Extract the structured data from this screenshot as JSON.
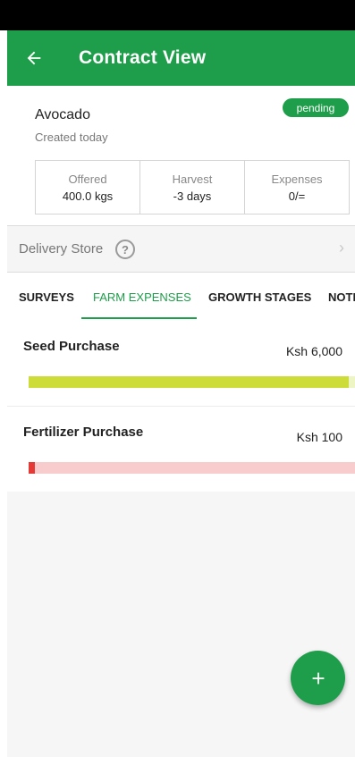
{
  "app_bar": {
    "title": "Contract View",
    "back_icon": "arrow-left-icon",
    "color": "#1e9e4a"
  },
  "contract": {
    "crop": "Avocado",
    "created": "Created today",
    "status": "pending"
  },
  "stats": [
    {
      "label": "Offered",
      "value": "400.0 kgs"
    },
    {
      "label": "Harvest",
      "value": "-3 days"
    },
    {
      "label": "Expenses",
      "value": "0/="
    }
  ],
  "delivery": {
    "label": "Delivery Store",
    "help_icon": "help-circle-icon",
    "chevron_icon": "chevron-right-icon"
  },
  "tabs": [
    {
      "label": "SURVEYS",
      "active": false
    },
    {
      "label": "FARM EXPENSES",
      "active": true
    },
    {
      "label": "GROWTH STAGES",
      "active": false
    },
    {
      "label": "NOTES",
      "active": false
    }
  ],
  "expenses": [
    {
      "name": "Seed Purchase",
      "amount": "Ksh 6,000",
      "progress": 0.98,
      "fill_color": "#cddc39",
      "track_color": "#eef5c5"
    },
    {
      "name": "Fertilizer Purchase",
      "amount": "Ksh 100",
      "progress": 0.02,
      "fill_color": "#e53935",
      "track_color": "#f8cccc"
    }
  ],
  "fab": {
    "icon": "plus-icon"
  }
}
